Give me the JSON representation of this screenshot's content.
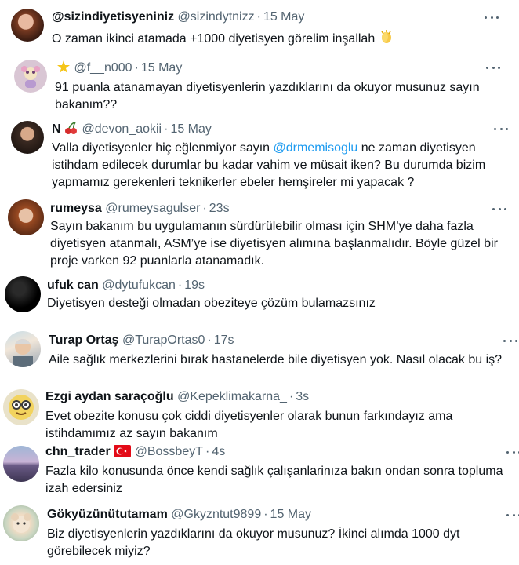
{
  "colors": {
    "text": "#0f1419",
    "muted": "#536471",
    "link": "#1d9bf0"
  },
  "tweets": [
    {
      "name": "@sizindiyetisyeniniz",
      "handle": "@sizindytnizz",
      "time": "15 May",
      "text": "O zaman ikinci atamada +1000 diyetisyen görelim inşallah",
      "emoji": "clapping-hands"
    },
    {
      "name": "",
      "handle": "@f__n000",
      "time": "15 May",
      "name_emoji": "dizzy-star",
      "text": "91 puanla atanamayan diyetisyenlerin yazdıklarını da okuyor musunuz sayın bakanım??"
    },
    {
      "name": "N",
      "handle": "@devon_aokii",
      "time": "15 May",
      "name_emoji": "cherries",
      "text_before": "Valla diyetisyenler hiç eğlenmiyor sayın ",
      "mention": "@drmemisoglu",
      "text_after": " ne zaman diyetisyen istihdam edilecek durumlar bu kadar vahim ve müsait iken? Bu durumda bizim yapmamız gerekenleri teknikerler ebeler hemşireler mi yapacak ?"
    },
    {
      "name": "rumeysa",
      "handle": "@rumeysagulser",
      "time": "23s",
      "text": "Sayın bakanım bu uygulamanın sürdürülebilir olması için SHM’ye daha fazla diyetisyen atanmalı, ASM’ye ise diyetisyen alımına başlanmalıdır. Böyle güzel bir proje varken 92 puanlarla atanamadık."
    },
    {
      "name": "ufuk can",
      "handle": "@dytufukcan",
      "time": "19s",
      "text": "Diyetisyen desteği olmadan obeziteye çözüm bulamazsınız"
    },
    {
      "name": "Turap Ortaş",
      "handle": "@TurapOrtas0",
      "time": "17s",
      "text": "Aile sağlık merkezlerini bırak hastanelerde bile diyetisyen yok. Nasıl olacak bu iş?"
    },
    {
      "name": "Ezgi aydan saraçoğlu",
      "handle": "@Kepeklimakarna_",
      "time": "3s",
      "text": "Evet obezite konusu çok ciddi diyetisyenler olarak bunun farkındayız ama istihdamımız az sayın bakanım"
    },
    {
      "name": "chn_trader",
      "handle": "@BossbeyT",
      "time": "4s",
      "name_emoji": "turkey-flag",
      "text": "Fazla kilo konusunda önce kendi sağlık çalışanlarinıza bakın ondan sonra topluma izah edersiniz"
    },
    {
      "name": "Gökyüzünütutamam",
      "handle": "@Gkyzntut9899",
      "time": "15 May",
      "text": "Biz diyetisyenlerin yazdıklarını da okuyor musunuz? İkinci alımda 1000 dyt görebilecek miyiz?"
    }
  ]
}
